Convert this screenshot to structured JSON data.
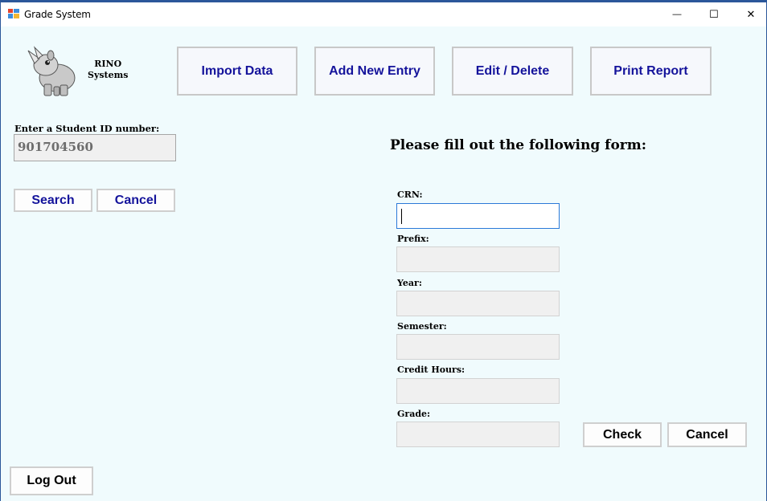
{
  "window": {
    "title": "Grade System",
    "min_glyph": "—",
    "max_glyph": "☐",
    "close_glyph": "✕"
  },
  "brand": {
    "line1": "RINO",
    "line2": "Systems"
  },
  "nav": {
    "import": "Import Data",
    "add": "Add New Entry",
    "edit": "Edit / Delete",
    "print": "Print Report"
  },
  "search": {
    "label": "Enter a Student ID number:",
    "value": "901704560",
    "search_label": "Search",
    "cancel_label": "Cancel"
  },
  "form": {
    "title": "Please fill out the following form:",
    "crn_label": "CRN:",
    "crn_value": "",
    "prefix_label": "Prefix:",
    "prefix_value": "",
    "year_label": "Year:",
    "year_value": "",
    "semester_label": "Semester:",
    "semester_value": "",
    "credit_label": "Credit Hours:",
    "credit_value": "",
    "grade_label": "Grade:",
    "grade_value": "",
    "check_label": "Check",
    "cancel_label": "Cancel"
  },
  "logout_label": "Log Out",
  "colors": {
    "client_bg": "#f0fbfd",
    "nav_text": "#14139b",
    "window_border": "#2b579a",
    "focus_border": "#2b79d8"
  }
}
